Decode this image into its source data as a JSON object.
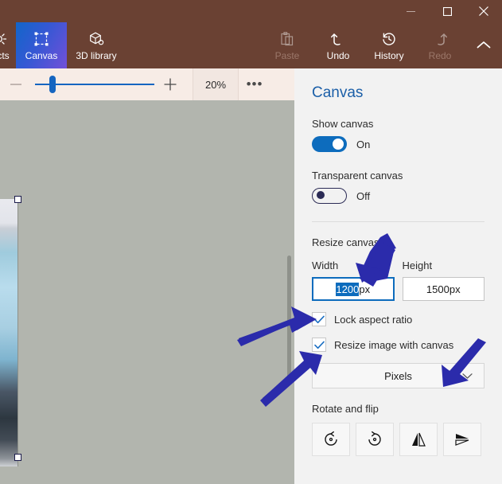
{
  "window": {
    "controls": [
      {
        "name": "minimize",
        "glyph": "minimize-icon",
        "disabled": true
      },
      {
        "name": "maximize",
        "glyph": "maximize-icon",
        "disabled": false
      },
      {
        "name": "close",
        "glyph": "close-icon",
        "disabled": false
      }
    ],
    "titlebar_color": "#6a4133"
  },
  "ribbon": {
    "left_items": [
      {
        "label": "fects",
        "icon": "effects-icon",
        "active": false,
        "disabled": false,
        "truncated": true
      },
      {
        "label": "Canvas",
        "icon": "canvas-icon",
        "active": true,
        "disabled": false
      },
      {
        "label": "3D library",
        "icon": "3d-library-icon",
        "active": false,
        "disabled": false
      }
    ],
    "right_items": [
      {
        "label": "Paste",
        "icon": "paste-icon",
        "disabled": true
      },
      {
        "label": "Undo",
        "icon": "undo-icon",
        "disabled": false
      },
      {
        "label": "History",
        "icon": "history-icon",
        "disabled": false
      },
      {
        "label": "Redo",
        "icon": "redo-icon",
        "disabled": true
      }
    ],
    "expand_icon": "chevron-up-icon",
    "active_tab_gradient": [
      "#1266c9",
      "#7250d8"
    ]
  },
  "zoombar": {
    "zoom_out_label": "−",
    "zoom_in_label": "+",
    "zoom_level": "20%",
    "more_label": "•••",
    "slider_value": 12
  },
  "canvas": {
    "background_color": "#b2b5ae",
    "selection_handles": 2
  },
  "panel": {
    "title": "Canvas",
    "show_canvas": {
      "label": "Show canvas",
      "state": "On",
      "on": true
    },
    "transparent_canvas": {
      "label": "Transparent canvas",
      "state": "Off",
      "on": false
    },
    "resize": {
      "section_label": "Resize canvas",
      "width_label": "Width",
      "height_label": "Height",
      "width_value": "1200",
      "width_unit": "px",
      "height_value": "1500",
      "height_unit": "px",
      "width_selected": true,
      "lock_aspect_ratio": {
        "label": "Lock aspect ratio",
        "checked": true
      },
      "resize_image_with_canvas": {
        "label": "Resize image with canvas",
        "checked": true
      },
      "unit_select": {
        "value": "Pixels",
        "chevron": "chevron-down-icon"
      }
    },
    "rotate_and_flip": {
      "label": "Rotate and flip",
      "buttons": [
        {
          "name": "rotate-left-button",
          "icon": "rotate-left-icon"
        },
        {
          "name": "rotate-right-button",
          "icon": "rotate-right-icon"
        },
        {
          "name": "flip-horizontal-button",
          "icon": "flip-horizontal-icon"
        },
        {
          "name": "flip-vertical-button",
          "icon": "flip-vertical-icon"
        }
      ]
    }
  },
  "annotations": {
    "arrow_color": "#2b2bab",
    "arrows": [
      {
        "name": "arrow-to-width-field",
        "points_to": "width-input"
      },
      {
        "name": "arrow-to-lock-aspect-ratio",
        "points_to": "lock-aspect-ratio-checkbox"
      },
      {
        "name": "arrow-to-resize-image-with-canvas",
        "points_to": "resize-image-with-canvas-checkbox"
      },
      {
        "name": "arrow-to-unit-select",
        "points_to": "unit-select"
      }
    ]
  }
}
